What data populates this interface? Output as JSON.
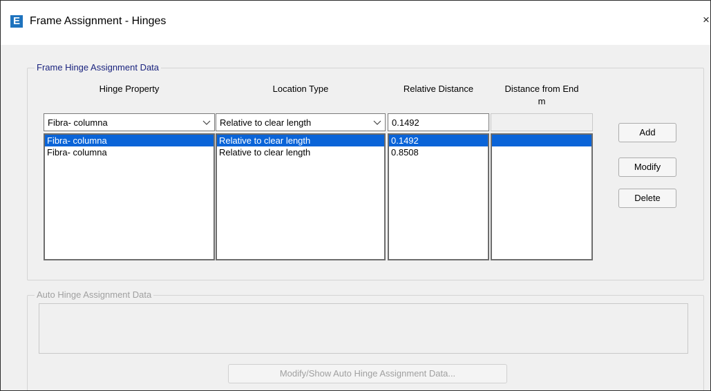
{
  "window": {
    "title": "Frame Assignment - Hinges",
    "app_icon_letter": "E",
    "close_glyph": "×"
  },
  "hinge_group": {
    "legend": "Frame Hinge Assignment Data",
    "headers": {
      "hinge_property": "Hinge Property",
      "location_type": "Location Type",
      "relative_distance": "Relative Distance",
      "distance_from_end": "Distance from End",
      "distance_unit": "m"
    },
    "inputs": {
      "hinge_property": "Fibra- columna",
      "location_type": "Relative to clear length",
      "relative_distance": "0.1492",
      "distance_from_end": ""
    },
    "rows": [
      {
        "hinge_property": "Fibra- columna",
        "location_type": "Relative to clear length",
        "relative_distance": "0.1492",
        "distance_from_end": "",
        "selected": true
      },
      {
        "hinge_property": "Fibra- columna",
        "location_type": "Relative to clear length",
        "relative_distance": "0.8508",
        "distance_from_end": "",
        "selected": false
      }
    ],
    "buttons": {
      "add": "Add",
      "modify": "Modify",
      "delete": "Delete"
    }
  },
  "auto_group": {
    "legend": "Auto Hinge Assignment Data",
    "button_label": "Modify/Show Auto Hinge Assignment Data..."
  },
  "colors": {
    "selection": "#0a64d8",
    "legend_active": "#1a237e",
    "disabled_text": "#a0a0a0",
    "app_icon": "#1e73be"
  }
}
